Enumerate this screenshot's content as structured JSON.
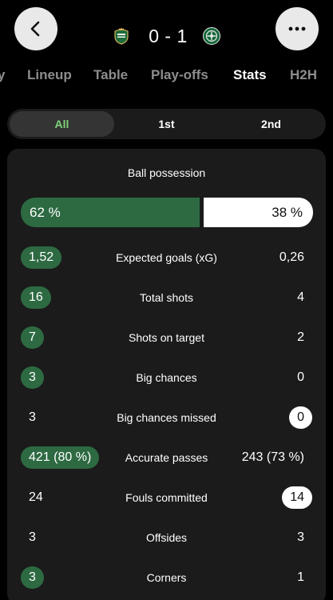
{
  "header": {
    "back_icon": "chevron-left-icon",
    "more_icon": "ellipsis-icon",
    "score": "0 - 1",
    "home_crest": "rapid-wien-crest",
    "away_crest": "panathinaikos-crest"
  },
  "tabs": [
    {
      "label": "y"
    },
    {
      "label": "Lineup"
    },
    {
      "label": "Table"
    },
    {
      "label": "Play-offs"
    },
    {
      "label": "Stats",
      "active": true
    },
    {
      "label": "H2H"
    }
  ],
  "segments": [
    {
      "label": "All",
      "active": true
    },
    {
      "label": "1st"
    },
    {
      "label": "2nd"
    }
  ],
  "possession": {
    "title": "Ball possession",
    "home": "62 %",
    "away": "38 %",
    "home_fraction": 0.62
  },
  "stats": [
    {
      "label": "Expected goals (xG)",
      "home": "1,52",
      "away": "0,26",
      "highlight": "home"
    },
    {
      "label": "Total shots",
      "home": "16",
      "away": "4",
      "highlight": "home"
    },
    {
      "label": "Shots on target",
      "home": "7",
      "away": "2",
      "highlight": "home"
    },
    {
      "label": "Big chances",
      "home": "3",
      "away": "0",
      "highlight": "home"
    },
    {
      "label": "Big chances missed",
      "home": "3",
      "away": "0",
      "highlight": "away"
    },
    {
      "label": "Accurate passes",
      "home": "421 (80 %)",
      "away": "243 (73 %)",
      "highlight": "home"
    },
    {
      "label": "Fouls committed",
      "home": "24",
      "away": "14",
      "highlight": "away"
    },
    {
      "label": "Offsides",
      "home": "3",
      "away": "3",
      "highlight": "none"
    },
    {
      "label": "Corners",
      "home": "3",
      "away": "1",
      "highlight": "home"
    }
  ],
  "colors": {
    "background": "#000000",
    "card": "#1b1b1b",
    "accent_green": "#2d6a42",
    "active_segment_text": "#7ed27a",
    "inactive_tab": "#8d8d8d"
  }
}
